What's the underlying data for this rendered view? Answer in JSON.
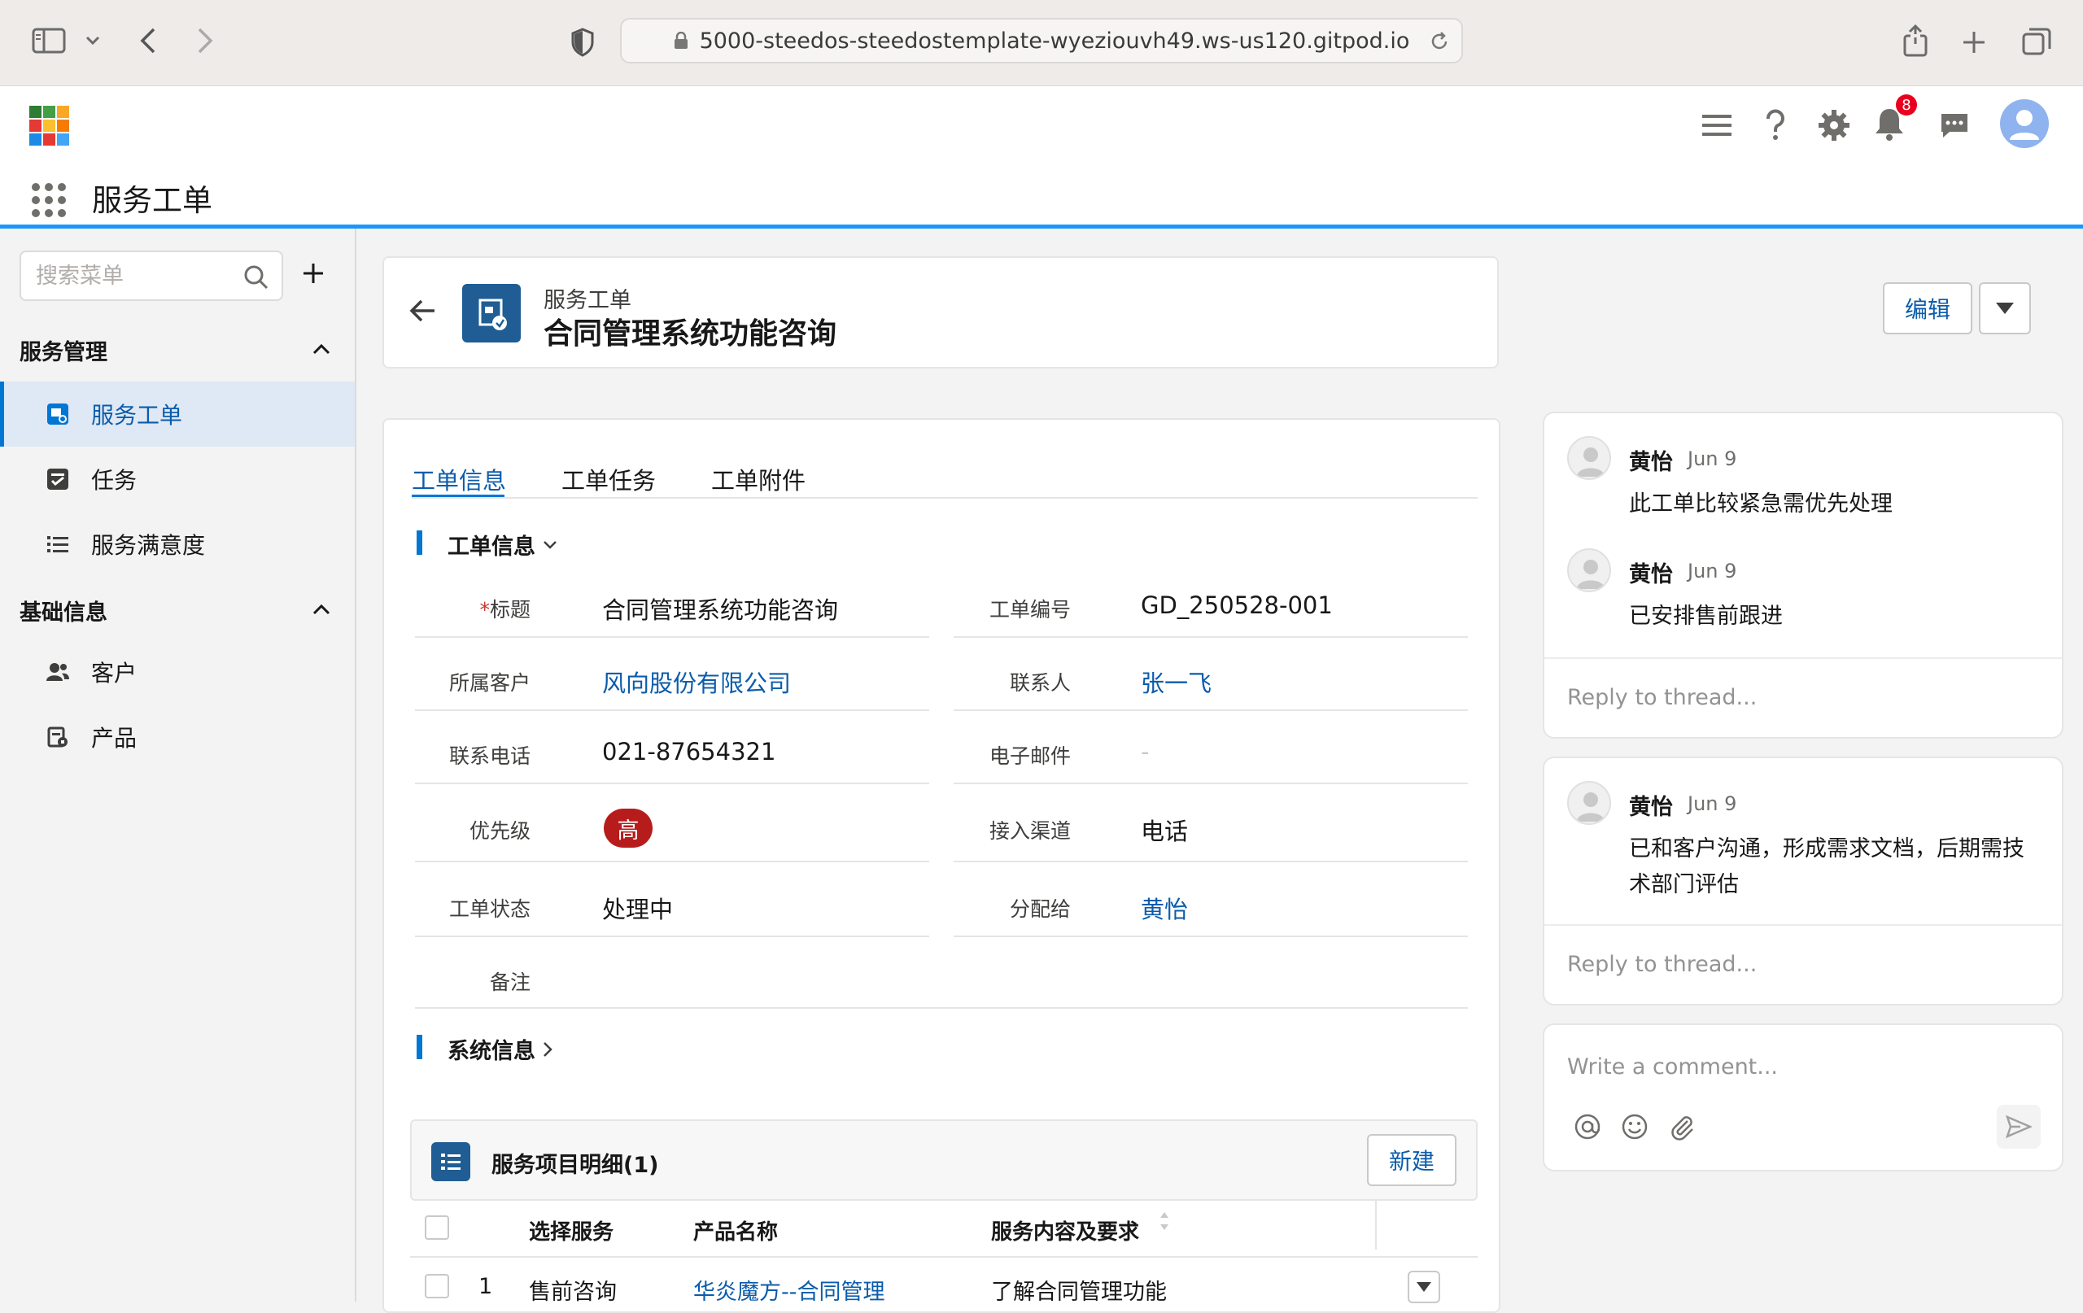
{
  "browser": {
    "url": "5000-steedos-steedostemplate-wyeziouvh49.ws-us120.gitpod.io"
  },
  "app": {
    "name": "服务工单",
    "notification_count": "8"
  },
  "sidebar": {
    "search_placeholder": "搜索菜单",
    "groups": [
      {
        "label": "服务管理",
        "items": [
          {
            "label": "服务工单"
          },
          {
            "label": "任务"
          },
          {
            "label": "服务满意度"
          }
        ]
      },
      {
        "label": "基础信息",
        "items": [
          {
            "label": "客户"
          },
          {
            "label": "产品"
          }
        ]
      }
    ]
  },
  "record": {
    "object_label": "服务工单",
    "title": "合同管理系统功能咨询",
    "edit_label": "编辑"
  },
  "tabs": [
    "工单信息",
    "工单任务",
    "工单附件"
  ],
  "section_info": "工单信息",
  "section_system": "系统信息",
  "fields": {
    "title_label": "标题",
    "title_required_mark": "*",
    "title_value": "合同管理系统功能咨询",
    "number_label": "工单编号",
    "number_value": "GD_250528-001",
    "customer_label": "所属客户",
    "customer_value": "风向股份有限公司",
    "contact_label": "联系人",
    "contact_value": "张一飞",
    "phone_label": "联系电话",
    "phone_value": "021-87654321",
    "email_label": "电子邮件",
    "email_value": "-",
    "priority_label": "优先级",
    "priority_value": "高",
    "channel_label": "接入渠道",
    "channel_value": "电话",
    "status_label": "工单状态",
    "status_value": "处理中",
    "assignee_label": "分配给",
    "assignee_value": "黄怡",
    "remark_label": "备注"
  },
  "related": {
    "title": "服务项目明细(1)",
    "new_label": "新建",
    "columns": [
      "选择服务",
      "产品名称",
      "服务内容及要求"
    ],
    "rows": [
      {
        "index": "1",
        "service": "售前咨询",
        "product": "华炎魔方--合同管理",
        "content": "了解合同管理功能"
      }
    ]
  },
  "comments": {
    "threads": [
      {
        "posts": [
          {
            "author": "黄怡",
            "date": "Jun 9",
            "text": "此工单比较紧急需优先处理"
          },
          {
            "author": "黄怡",
            "date": "Jun 9",
            "text": "已安排售前跟进"
          }
        ],
        "reply_placeholder": "Reply to thread..."
      },
      {
        "posts": [
          {
            "author": "黄怡",
            "date": "Jun 9",
            "text": "已和客户沟通，形成需求文档，后期需技术部门评估"
          }
        ],
        "reply_placeholder": "Reply to thread..."
      }
    ],
    "composer_placeholder": "Write a comment..."
  },
  "colors": {
    "brand_blue": "#0176d3",
    "link": "#0b5cab",
    "priority_high": "#b71c1c",
    "header_border": "#1b96ff"
  }
}
